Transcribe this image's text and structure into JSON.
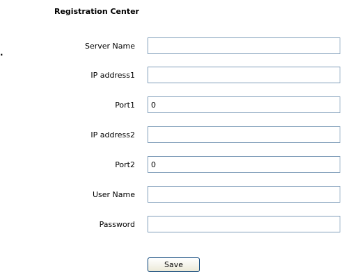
{
  "page": {
    "title": "Registration Center",
    "marker": "."
  },
  "form": {
    "server_name": {
      "label": "Server Name",
      "value": ""
    },
    "ip_address1": {
      "label": "IP address1",
      "value": ""
    },
    "port1": {
      "label": "Port1",
      "value": "0"
    },
    "ip_address2": {
      "label": "IP address2",
      "value": ""
    },
    "port2": {
      "label": "Port2",
      "value": "0"
    },
    "user_name": {
      "label": "User Name",
      "value": ""
    },
    "password": {
      "label": "Password",
      "value": ""
    }
  },
  "actions": {
    "save_label": "Save"
  }
}
